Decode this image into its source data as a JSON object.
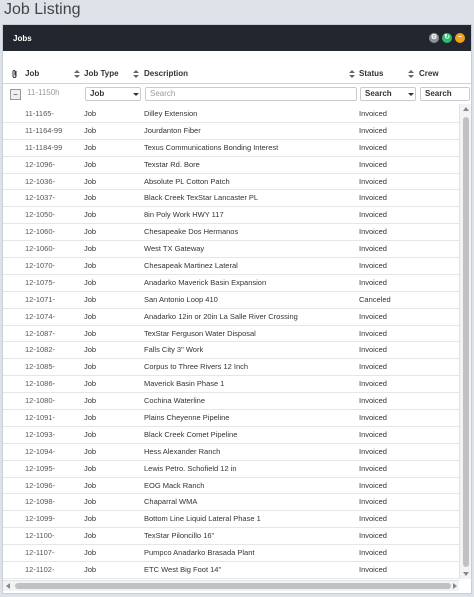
{
  "page": {
    "title": "Job Listing"
  },
  "panel": {
    "title": "Jobs"
  },
  "header_buttons": [
    {
      "icon": "gear-icon",
      "color": "#8a9099",
      "glyph": "⚙"
    },
    {
      "icon": "refresh-icon",
      "color": "#2ebd6b",
      "glyph": "↻"
    },
    {
      "icon": "minus-icon",
      "color": "#f0a21a",
      "glyph": "−"
    }
  ],
  "columns": {
    "job": "Job",
    "job_type": "Job Type",
    "description": "Description",
    "status": "Status",
    "crew": "Crew"
  },
  "filters": {
    "job_value": "11-1150h",
    "job_type_value": "Job",
    "description_placeholder": "Search",
    "status_value": "Search",
    "crew_value": "Search"
  },
  "rows": [
    {
      "job": "11-1165-",
      "type": "Job",
      "description": "Dilley Extension",
      "status": "Invoiced"
    },
    {
      "job": "11-1164-99",
      "type": "Job",
      "description": "Jourdanton Fiber",
      "status": "Invoiced"
    },
    {
      "job": "11-1184-99",
      "type": "Job",
      "description": "Texus Communications Bonding Interest",
      "status": "Invoiced"
    },
    {
      "job": "12-1096-",
      "type": "Job",
      "description": "Texstar Rd. Bore",
      "status": "Invoiced"
    },
    {
      "job": "12-1036-",
      "type": "Job",
      "description": "Absolute PL Cotton Patch",
      "status": "Invoiced"
    },
    {
      "job": "12-1037-",
      "type": "Job",
      "description": "Black Creek TexStar Lancaster PL",
      "status": "Invoiced"
    },
    {
      "job": "12-1050-",
      "type": "Job",
      "description": "8in Poly Work HWY 117",
      "status": "Invoiced"
    },
    {
      "job": "12-1060-",
      "type": "Job",
      "description": "Chesapeake Dos Hermanos",
      "status": "Invoiced"
    },
    {
      "job": "12-1060-",
      "type": "Job",
      "description": "West TX Gateway",
      "status": "Invoiced"
    },
    {
      "job": "12-1070-",
      "type": "Job",
      "description": "Chesapeak Martinez Lateral",
      "status": "Invoiced"
    },
    {
      "job": "12-1075-",
      "type": "Job",
      "description": "Anadarko Maverick Basin Expansion",
      "status": "Invoiced"
    },
    {
      "job": "12-1071-",
      "type": "Job",
      "description": "San Antonio Loop 410",
      "status": "Canceled"
    },
    {
      "job": "12-1074-",
      "type": "Job",
      "description": "Anadarko 12in or 20in La Salle River Crossing",
      "status": "Invoiced"
    },
    {
      "job": "12-1087-",
      "type": "Job",
      "description": "TexStar Ferguson Water Disposal",
      "status": "Invoiced"
    },
    {
      "job": "12-1082-",
      "type": "Job",
      "description": "Falls City 3\" Work",
      "status": "Invoiced"
    },
    {
      "job": "12-1085-",
      "type": "Job",
      "description": "Corpus to Three Rivers 12 Inch",
      "status": "Invoiced"
    },
    {
      "job": "12-1086-",
      "type": "Job",
      "description": "Maverick Basin Phase 1",
      "status": "Invoiced"
    },
    {
      "job": "12-1080-",
      "type": "Job",
      "description": "Cochina Waterline",
      "status": "Invoiced"
    },
    {
      "job": "12-1091-",
      "type": "Job",
      "description": "Plains Cheyenne Pipeline",
      "status": "Invoiced"
    },
    {
      "job": "12-1093-",
      "type": "Job",
      "description": "Black Creek Comet Pipeline",
      "status": "Invoiced"
    },
    {
      "job": "12-1094-",
      "type": "Job",
      "description": "Hess Alexander Ranch",
      "status": "Invoiced"
    },
    {
      "job": "12-1095-",
      "type": "Job",
      "description": "Lewis Petro. Schofield 12 in",
      "status": "Invoiced"
    },
    {
      "job": "12-1096-",
      "type": "Job",
      "description": "EOG Mack Ranch",
      "status": "Invoiced"
    },
    {
      "job": "12-1098-",
      "type": "Job",
      "description": "Chaparral WMA",
      "status": "Invoiced"
    },
    {
      "job": "12-1099-",
      "type": "Job",
      "description": "Bottom Line Liquid Lateral Phase 1",
      "status": "Invoiced"
    },
    {
      "job": "12-1100-",
      "type": "Job",
      "description": "TexStar Piloncillo 16\"",
      "status": "Invoiced"
    },
    {
      "job": "12-1107-",
      "type": "Job",
      "description": "Pumpco Anadarko Brasada Plant",
      "status": "Invoiced"
    },
    {
      "job": "12-1102-",
      "type": "Job",
      "description": "ETC West Big Foot 14\"",
      "status": "Invoiced"
    }
  ]
}
